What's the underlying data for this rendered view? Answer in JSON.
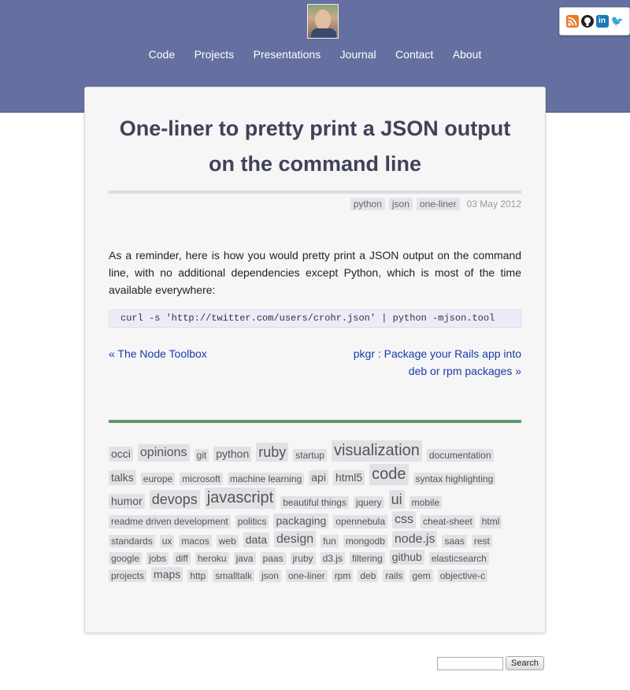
{
  "nav": [
    "Code",
    "Projects",
    "Presentations",
    "Journal",
    "Contact",
    "About"
  ],
  "social": {
    "icons": [
      "rss-icon",
      "github-icon",
      "linkedin-icon",
      "twitter-icon"
    ],
    "linkedin_glyph": "in",
    "twitter_glyph": "🐦"
  },
  "post": {
    "title": "One-liner to pretty print a JSON output on the command line",
    "tags": [
      "python",
      "json",
      "one-liner"
    ],
    "date": "03 May 2012",
    "body": "As a reminder, here is how you would pretty print a JSON output on the command line, with no additional dependencies except Python, which is most of the time available everywhere:",
    "code": "curl -s 'http://twitter.com/users/crohr.json' | python -mjson.tool"
  },
  "pager": {
    "prev": "« The Node Toolbox",
    "next": "pkgr : Package your Rails app into deb or rpm packages »"
  },
  "tag_cloud": [
    {
      "label": "occi",
      "size": 14
    },
    {
      "label": "opinions",
      "size": 16
    },
    {
      "label": "git",
      "size": 12
    },
    {
      "label": "python",
      "size": 14
    },
    {
      "label": "ruby",
      "size": 18
    },
    {
      "label": "startup",
      "size": 12
    },
    {
      "label": "visualization",
      "size": 20
    },
    {
      "label": "documentation",
      "size": 12
    },
    {
      "label": "talks",
      "size": 14
    },
    {
      "label": "europe",
      "size": 12
    },
    {
      "label": "microsoft",
      "size": 12
    },
    {
      "label": "machine learning",
      "size": 12
    },
    {
      "label": "api",
      "size": 14
    },
    {
      "label": "html5",
      "size": 14
    },
    {
      "label": "code",
      "size": 20
    },
    {
      "label": "syntax highlighting",
      "size": 12
    },
    {
      "label": "humor",
      "size": 14
    },
    {
      "label": "devops",
      "size": 18
    },
    {
      "label": "javascript",
      "size": 20
    },
    {
      "label": "beautiful things",
      "size": 12
    },
    {
      "label": "jquery",
      "size": 12
    },
    {
      "label": "ui",
      "size": 18
    },
    {
      "label": "mobile",
      "size": 12
    },
    {
      "label": "readme driven development",
      "size": 12
    },
    {
      "label": "politics",
      "size": 12
    },
    {
      "label": "packaging",
      "size": 14
    },
    {
      "label": "opennebula",
      "size": 12
    },
    {
      "label": "css",
      "size": 16
    },
    {
      "label": "cheat-sheet",
      "size": 12
    },
    {
      "label": "html",
      "size": 12
    },
    {
      "label": "standards",
      "size": 12
    },
    {
      "label": "ux",
      "size": 12
    },
    {
      "label": "macos",
      "size": 12
    },
    {
      "label": "web",
      "size": 12
    },
    {
      "label": "data",
      "size": 14
    },
    {
      "label": "design",
      "size": 16
    },
    {
      "label": "fun",
      "size": 12
    },
    {
      "label": "mongodb",
      "size": 12
    },
    {
      "label": "node.js",
      "size": 16
    },
    {
      "label": "saas",
      "size": 12
    },
    {
      "label": "rest",
      "size": 12
    },
    {
      "label": "google",
      "size": 12
    },
    {
      "label": "jobs",
      "size": 12
    },
    {
      "label": "diff",
      "size": 12
    },
    {
      "label": "heroku",
      "size": 12
    },
    {
      "label": "java",
      "size": 12
    },
    {
      "label": "paas",
      "size": 12
    },
    {
      "label": "jruby",
      "size": 12
    },
    {
      "label": "d3.js",
      "size": 12
    },
    {
      "label": "filtering",
      "size": 12
    },
    {
      "label": "github",
      "size": 14
    },
    {
      "label": "elasticsearch",
      "size": 12
    },
    {
      "label": "projects",
      "size": 12
    },
    {
      "label": "maps",
      "size": 14
    },
    {
      "label": "http",
      "size": 12
    },
    {
      "label": "smalltalk",
      "size": 12
    },
    {
      "label": "json",
      "size": 12
    },
    {
      "label": "one-liner",
      "size": 12
    },
    {
      "label": "rpm",
      "size": 12
    },
    {
      "label": "deb",
      "size": 12
    },
    {
      "label": "rails",
      "size": 12
    },
    {
      "label": "gem",
      "size": 12
    },
    {
      "label": "objective-c",
      "size": 12
    }
  ],
  "search": {
    "button": "Search",
    "value": ""
  }
}
